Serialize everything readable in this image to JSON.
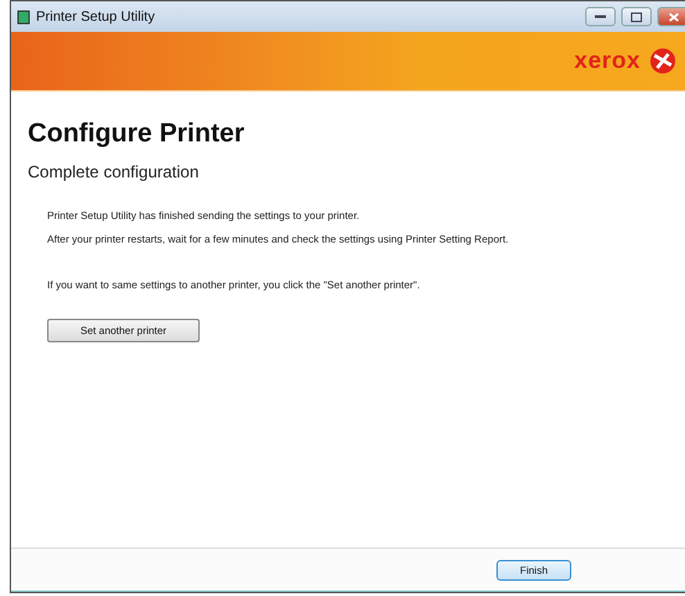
{
  "window": {
    "title": "Printer Setup Utility"
  },
  "banner": {
    "logo": "xerox"
  },
  "heading": "Configure Printer",
  "subheading": "Complete configuration",
  "messages": [
    "Printer Setup Utility has finished sending the settings to your printer.",
    "After your printer restarts, wait for a few minutes and check the settings using Printer Setting Report.",
    "If you want to same settings to another printer, you click the \"Set another printer\"."
  ],
  "action_button": "Set another printer",
  "footer_button": "Finish"
}
